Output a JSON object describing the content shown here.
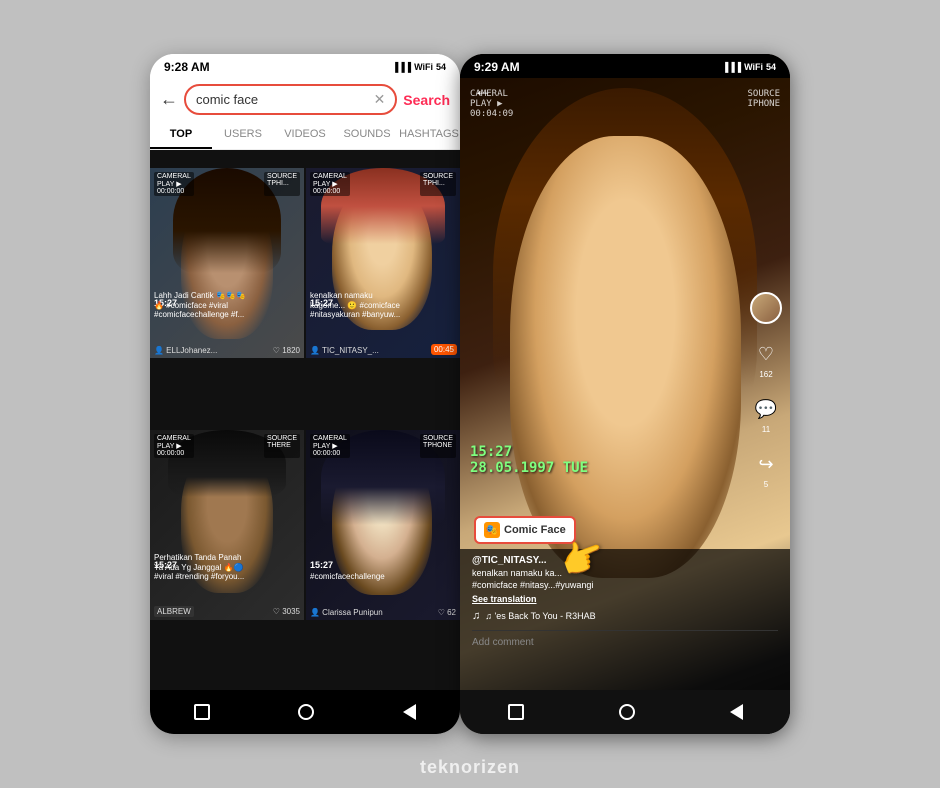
{
  "left_phone": {
    "status_time": "9:28 AM",
    "search_query": "comic face",
    "search_btn_label": "Search",
    "tabs": [
      "TOP",
      "USERS",
      "VIDEOS",
      "SOUNDS",
      "HASHTAGS"
    ],
    "active_tab": "TOP",
    "videos": [
      {
        "duration": "15:27",
        "caption": "Lahh Jadi Cantik 🎭🎭🎭\n🔥 #comicface #viral\n#comicfacechallenge #f...",
        "user": "ELLJohanez...",
        "likes": "1820"
      },
      {
        "duration": "15:27",
        "caption": "kenalkan namaku\nkagome... 🙂 #comicface\n#nitasyakuran #banyuw...",
        "user": "TIC_NITASY_...",
        "likes": "",
        "badge": "00:45"
      },
      {
        "duration": "15:27",
        "caption": "Perhatikan Tanda Panah\nYa Ada Yg Janggal 🔥🔵\n#viral #trending #foryou...",
        "user": "ALBREW",
        "likes": "3035"
      },
      {
        "duration": "15:27",
        "caption": "#comicfacechallenge",
        "user": "Clarissa Punipun",
        "likes": "62"
      }
    ]
  },
  "right_phone": {
    "status_time": "9:29 AM",
    "overlay_top_left": "CAMERAL\nPLAY ▶\n00:04:09",
    "overlay_top_right": "SOURCE\nIPHONE",
    "timestamp_line1": "15:27",
    "timestamp_line2": "28.05.1997 TUE",
    "actions": {
      "likes": "162",
      "comments": "11",
      "shares": "5"
    },
    "comic_face_label": "Comic Face",
    "username": "@TIC_NITASY...",
    "caption_line1": "kenalkan namaku ka...",
    "caption_line2": "#comicface #nitasy...#yuwangi",
    "see_translation": "See translation",
    "music": "♫ 'es Back To You - R3HAB",
    "add_comment": "Add comment"
  },
  "watermark": "teknorizen",
  "nav_icons": {
    "square": "■",
    "circle": "●",
    "triangle": "◀"
  }
}
